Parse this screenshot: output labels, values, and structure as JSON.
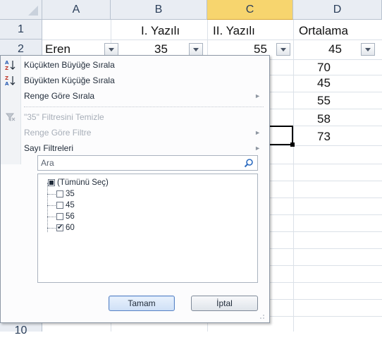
{
  "columns": [
    "A",
    "B",
    "C",
    "D"
  ],
  "rows": [
    "1",
    "2",
    "10"
  ],
  "headers": {
    "b1": "I. Yazılı",
    "c1": "II. Yazılı",
    "d1": "Ortalama"
  },
  "row2": {
    "a": "Eren",
    "b": "35",
    "c": "55",
    "d": "45"
  },
  "column_d_values": [
    "70",
    "45",
    "55",
    "58",
    "73"
  ],
  "menu": {
    "sort_asc": "Küçükten Büyüğe Sırala",
    "sort_desc": "Büyükten Küçüğe Sırala",
    "sort_color": "Renge Göre Sırala",
    "clear_filter": "\"35\" Filtresini Temizle",
    "filter_color": "Renge Göre Filtre",
    "number_filters": "Sayı Filtreleri",
    "search_placeholder": "Ara",
    "items": [
      {
        "label": "(Tümünü Seç)",
        "state": "partial"
      },
      {
        "label": "35",
        "state": "unchecked"
      },
      {
        "label": "45",
        "state": "unchecked"
      },
      {
        "label": "56",
        "state": "unchecked"
      },
      {
        "label": "60",
        "state": "checked"
      }
    ],
    "ok": "Tamam",
    "cancel": "İptal"
  },
  "colors": {
    "selected_header": "#f7d56e",
    "header_bg": "#e9edf3",
    "accent": "#5b84c4"
  }
}
